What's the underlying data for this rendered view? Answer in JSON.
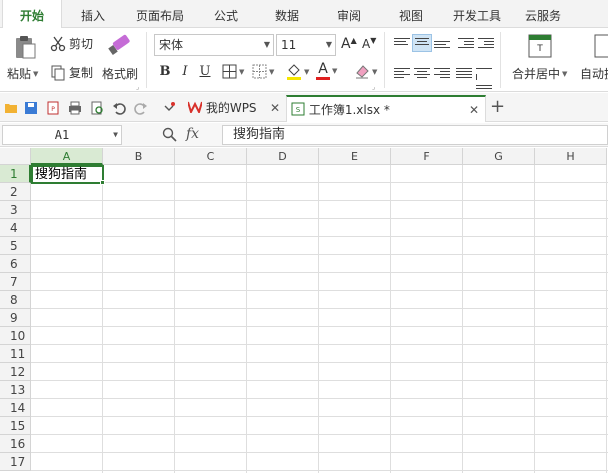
{
  "menu_tabs": [
    {
      "label": "开始",
      "active": true
    },
    {
      "label": "插入"
    },
    {
      "label": "页面布局"
    },
    {
      "label": "公式"
    },
    {
      "label": "数据"
    },
    {
      "label": "审阅"
    },
    {
      "label": "视图"
    },
    {
      "label": "开发工具"
    },
    {
      "label": "云服务"
    }
  ],
  "ribbon": {
    "paste_label": "粘贴",
    "cut_label": "剪切",
    "copy_label": "复制",
    "format_painter_label": "格式刷",
    "font_name": "宋体",
    "font_size": "11",
    "grow_font": "A",
    "shrink_font": "A",
    "bold": "B",
    "italic": "I",
    "underline": "U",
    "font_color_letter": "A",
    "merge_center_label": "合并居中",
    "auto_wrap_label": "自动换"
  },
  "doc_tabs": [
    {
      "label": "我的WPS",
      "active": false
    },
    {
      "label": "工作簿1.xlsx *",
      "active": true
    }
  ],
  "formula_bar": {
    "name_box": "A1",
    "fx_label": "fx",
    "content": "搜狗指南"
  },
  "grid": {
    "columns": [
      "A",
      "B",
      "C",
      "D",
      "E",
      "F",
      "G",
      "H"
    ],
    "rows": [
      "1",
      "2",
      "3",
      "4",
      "5",
      "6",
      "7",
      "8",
      "9",
      "10",
      "11",
      "12",
      "13",
      "14",
      "15",
      "16",
      "17"
    ],
    "active_cell_value": "搜狗指南"
  },
  "colors": {
    "accent": "#2e7d32",
    "wps_red": "#d8312b"
  }
}
